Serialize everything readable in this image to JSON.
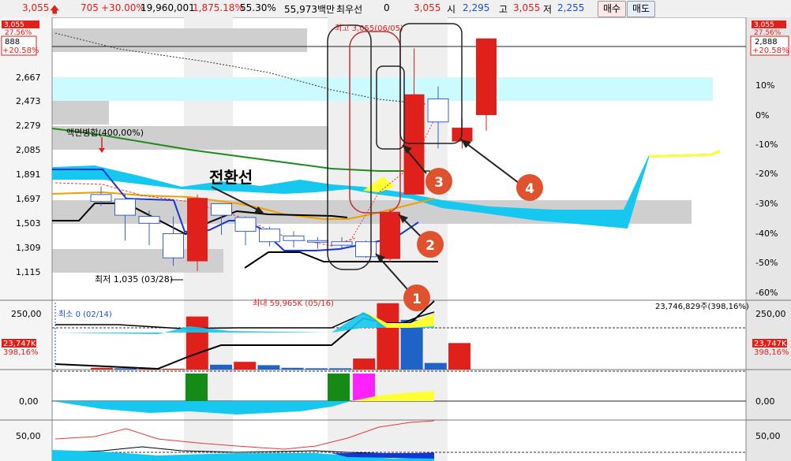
{
  "topbar": {
    "price": "3,055",
    "change": "705",
    "change_pct": "+30.00%",
    "volume": "19,960,001",
    "vol_ratio": "1,875.18%",
    "turnover": "55.30%",
    "amount": "55,973백만",
    "best_label": "최우선",
    "best_value": "0",
    "best_price": "3,055",
    "open_label": "시",
    "open": "2,295",
    "high_label": "고",
    "high": "3,055",
    "low_label": "저",
    "low": "2,255",
    "buy_button": "매수",
    "sell_button": "매도"
  },
  "left_tags": {
    "price_tag": "3,055",
    "pct_tag": "27.56%",
    "ref_tag": "888",
    "ref_pct": "+20.58%",
    "vol_tag": "23,747K",
    "vol_pct": "398,16%"
  },
  "right_tags": {
    "price_tag": "3,055",
    "pct_tag": "27.56%",
    "ref_tag": "2,888",
    "ref_pct": "+20.58%",
    "vol_tag": "23,747K",
    "vol_pct": "398,16%"
  },
  "price_axis": [
    "2,667",
    "2,473",
    "2,279",
    "2,085",
    "1,891",
    "1,697",
    "1,503",
    "1,309",
    "1,115"
  ],
  "pct_axis": [
    "10%",
    "0%",
    "-10%",
    "-20%",
    "-30%",
    "-40%",
    "-50%",
    "-60%"
  ],
  "volume_axis": "250,00",
  "osc_axis": "0,00",
  "bottom_axis": "50,00",
  "annotations": {
    "split_label": "액면병합(400,00%)",
    "conversion_line": "전환선",
    "low_label": "최저 1,035 (03/28)",
    "high_label": "최고 3,055(06/05)",
    "max_vol_label": "최대 59,965K (05/16)",
    "min_vol_label": "최소 0 (02/14)",
    "vol_summary": "23,746,829주(398,16%)",
    "markers": [
      "1",
      "2",
      "3",
      "4"
    ]
  },
  "chart_data": {
    "type": "candlestick",
    "price_range": [
      1035,
      3170
    ],
    "candles": [
      {
        "o": 1640,
        "h": 1770,
        "l": 1600,
        "c": 1700,
        "color": "blue"
      },
      {
        "o": 1520,
        "h": 1700,
        "l": 1300,
        "c": 1660,
        "color": "blue"
      },
      {
        "o": 1450,
        "h": 1560,
        "l": 1260,
        "c": 1510,
        "color": "blue"
      },
      {
        "o": 1150,
        "h": 1510,
        "l": 1080,
        "c": 1360,
        "color": "blue"
      },
      {
        "o": 1120,
        "h": 1700,
        "l": 1035,
        "c": 1670,
        "color": "red"
      },
      {
        "o": 1520,
        "h": 1610,
        "l": 1350,
        "c": 1620,
        "color": "blue"
      },
      {
        "o": 1380,
        "h": 1510,
        "l": 1260,
        "c": 1500,
        "color": "blue"
      },
      {
        "o": 1290,
        "h": 1420,
        "l": 1250,
        "c": 1400,
        "color": "blue"
      },
      {
        "o": 1300,
        "h": 1380,
        "l": 1240,
        "c": 1340,
        "color": "blue"
      },
      {
        "o": 1290,
        "h": 1330,
        "l": 1230,
        "c": 1300,
        "color": "blue"
      },
      {
        "o": 1260,
        "h": 1330,
        "l": 1220,
        "c": 1290,
        "color": "blue"
      },
      {
        "o": 1160,
        "h": 1300,
        "l": 1150,
        "c": 1290,
        "color": "blue"
      },
      {
        "o": 1140,
        "h": 1570,
        "l": 1110,
        "c": 1550,
        "color": "red"
      },
      {
        "o": 1700,
        "h": 2970,
        "l": 1700,
        "c": 2570,
        "color": "red"
      },
      {
        "o": 2330,
        "h": 2640,
        "l": 2100,
        "c": 2530,
        "color": "blue"
      },
      {
        "o": 2160,
        "h": 2360,
        "l": 2100,
        "c": 2280,
        "color": "red"
      },
      {
        "o": 2390,
        "h": 3055,
        "l": 2255,
        "c": 3055,
        "color": "red"
      }
    ],
    "volume_bars": [
      {
        "v": 8,
        "color": "red"
      },
      {
        "v": 6,
        "color": "blue"
      },
      {
        "v": 3,
        "color": "red"
      },
      {
        "v": 4,
        "color": "red"
      },
      {
        "v": 240,
        "color": "red"
      },
      {
        "v": 22,
        "color": "blue"
      },
      {
        "v": 35,
        "color": "red"
      },
      {
        "v": 20,
        "color": "blue"
      },
      {
        "v": 8,
        "color": "blue"
      },
      {
        "v": 6,
        "color": "blue"
      },
      {
        "v": 6,
        "color": "blue"
      },
      {
        "v": 50,
        "color": "red"
      },
      {
        "v": 300,
        "color": "red"
      },
      {
        "v": 225,
        "color": "blue"
      },
      {
        "v": 30,
        "color": "blue"
      },
      {
        "v": 120,
        "color": "red"
      }
    ]
  }
}
